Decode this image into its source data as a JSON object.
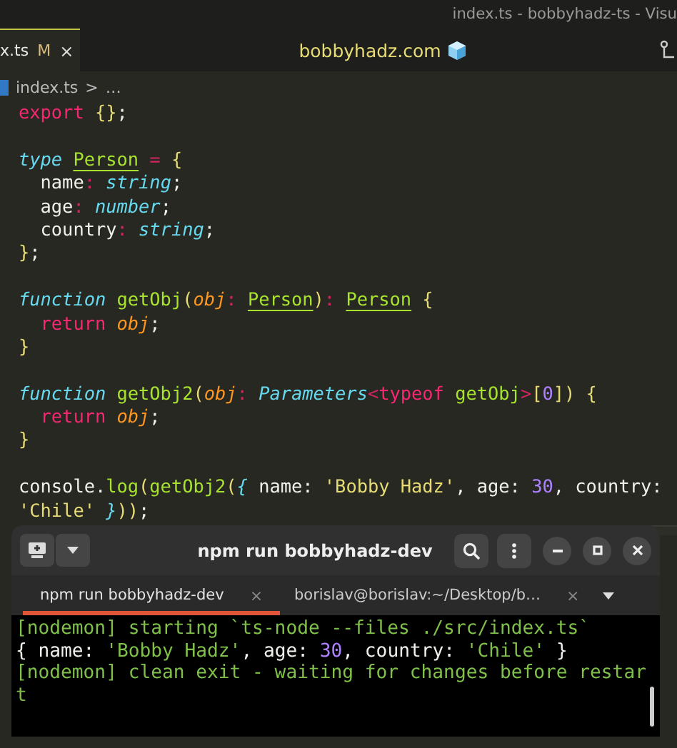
{
  "window": {
    "title": "index.ts - bobbyhadz-ts - Visu"
  },
  "editor_tab": {
    "label": "x.ts",
    "badge": "M",
    "close": "×"
  },
  "banner": {
    "text": "bobbyhadz.com"
  },
  "breadcrumb": {
    "file": "index.ts",
    "separator": ">",
    "rest": "…"
  },
  "code_lines": [
    {
      "tokens": [
        {
          "text": "export ",
          "kind": "kw"
        },
        {
          "text": "{}",
          "kind": "brace"
        },
        {
          "text": ";",
          "kind": "plain"
        }
      ]
    },
    {
      "gap_before": true,
      "tokens": [
        {
          "text": "type ",
          "kind": "storage"
        },
        {
          "text": "Person",
          "kind": "type"
        },
        {
          "text": " = ",
          "kind": "op"
        },
        {
          "text": "{",
          "kind": "brace"
        }
      ]
    },
    {
      "tokens": [
        {
          "text": "  name",
          "kind": "plain"
        },
        {
          "text": ": ",
          "kind": "op"
        },
        {
          "text": "string",
          "kind": "builtin"
        },
        {
          "text": ";",
          "kind": "plain"
        }
      ]
    },
    {
      "tokens": [
        {
          "text": "  age",
          "kind": "plain"
        },
        {
          "text": ": ",
          "kind": "op"
        },
        {
          "text": "number",
          "kind": "builtin"
        },
        {
          "text": ";",
          "kind": "plain"
        }
      ]
    },
    {
      "tokens": [
        {
          "text": "  country",
          "kind": "plain"
        },
        {
          "text": ": ",
          "kind": "op"
        },
        {
          "text": "string",
          "kind": "builtin"
        },
        {
          "text": ";",
          "kind": "plain"
        }
      ]
    },
    {
      "tokens": [
        {
          "text": "}",
          "kind": "brace"
        },
        {
          "text": ";",
          "kind": "plain"
        }
      ]
    },
    {
      "gap_before": true,
      "tokens": [
        {
          "text": "function ",
          "kind": "storage"
        },
        {
          "text": "getObj",
          "kind": "fn"
        },
        {
          "text": "(",
          "kind": "brace"
        },
        {
          "text": "obj",
          "kind": "param"
        },
        {
          "text": ": ",
          "kind": "op"
        },
        {
          "text": "Person",
          "kind": "type"
        },
        {
          "text": ")",
          "kind": "brace"
        },
        {
          "text": ": ",
          "kind": "op"
        },
        {
          "text": "Person",
          "kind": "type"
        },
        {
          "text": " {",
          "kind": "brace"
        }
      ]
    },
    {
      "tokens": [
        {
          "text": "  return ",
          "kind": "kw"
        },
        {
          "text": "obj",
          "kind": "param"
        },
        {
          "text": ";",
          "kind": "plain"
        }
      ]
    },
    {
      "tokens": [
        {
          "text": "}",
          "kind": "brace"
        }
      ]
    },
    {
      "gap_before": true,
      "tokens": [
        {
          "text": "function ",
          "kind": "storage"
        },
        {
          "text": "getObj2",
          "kind": "fn"
        },
        {
          "text": "(",
          "kind": "brace"
        },
        {
          "text": "obj",
          "kind": "param"
        },
        {
          "text": ": ",
          "kind": "op"
        },
        {
          "text": "Parameters",
          "kind": "builtin"
        },
        {
          "text": "<",
          "kind": "op"
        },
        {
          "text": "typeof ",
          "kind": "kw"
        },
        {
          "text": "getObj",
          "kind": "fn"
        },
        {
          "text": ">",
          "kind": "op"
        },
        {
          "text": "[",
          "kind": "brace"
        },
        {
          "text": "0",
          "kind": "number"
        },
        {
          "text": "]) {",
          "kind": "brace"
        }
      ]
    },
    {
      "tokens": [
        {
          "text": "  return ",
          "kind": "kw"
        },
        {
          "text": "obj",
          "kind": "param"
        },
        {
          "text": ";",
          "kind": "plain"
        }
      ]
    },
    {
      "tokens": [
        {
          "text": "}",
          "kind": "brace"
        }
      ]
    },
    {
      "gap_before": true,
      "tokens": [
        {
          "text": "console.",
          "kind": "plain"
        },
        {
          "text": "log",
          "kind": "fn"
        },
        {
          "text": "(",
          "kind": "brace"
        },
        {
          "text": "getObj2",
          "kind": "fn"
        },
        {
          "text": "(",
          "kind": "brace"
        },
        {
          "text": "{",
          "kind": "builtin"
        },
        {
          "text": " name: ",
          "kind": "plain"
        },
        {
          "text": "'Bobby Hadz'",
          "kind": "string"
        },
        {
          "text": ", age: ",
          "kind": "plain"
        },
        {
          "text": "30",
          "kind": "number"
        },
        {
          "text": ", country:",
          "kind": "plain"
        }
      ]
    },
    {
      "tokens": [
        {
          "text": "'Chile'",
          "kind": "string"
        },
        {
          "text": " }",
          "kind": "builtin"
        },
        {
          "text": "))",
          "kind": "brace"
        },
        {
          "text": ";",
          "kind": "plain"
        }
      ]
    }
  ],
  "terminal": {
    "title": "npm run bobbyhadz-dev",
    "tabs": [
      {
        "label": "npm run bobbyhadz-dev",
        "close": "×",
        "selected": true
      },
      {
        "label": "borislav@borislav:~/Desktop/b…",
        "close": "×",
        "selected": false
      }
    ],
    "output": [
      {
        "tokens": [
          {
            "text": "[nodemon] starting `ts-node --files ./src/index.ts`",
            "kind": "green"
          }
        ]
      },
      {
        "tokens": [
          {
            "text": "{ name: ",
            "kind": "plain"
          },
          {
            "text": "'Bobby Hadz'",
            "kind": "green"
          },
          {
            "text": ", age: ",
            "kind": "plain"
          },
          {
            "text": "30",
            "kind": "number"
          },
          {
            "text": ", country: ",
            "kind": "plain"
          },
          {
            "text": "'Chile'",
            "kind": "green"
          },
          {
            "text": " }",
            "kind": "plain"
          }
        ]
      },
      {
        "tokens": [
          {
            "text": "[nodemon] clean exit - waiting for changes before restar",
            "kind": "green"
          }
        ]
      },
      {
        "tokens": [
          {
            "text": "t",
            "kind": "green"
          }
        ]
      }
    ]
  }
}
